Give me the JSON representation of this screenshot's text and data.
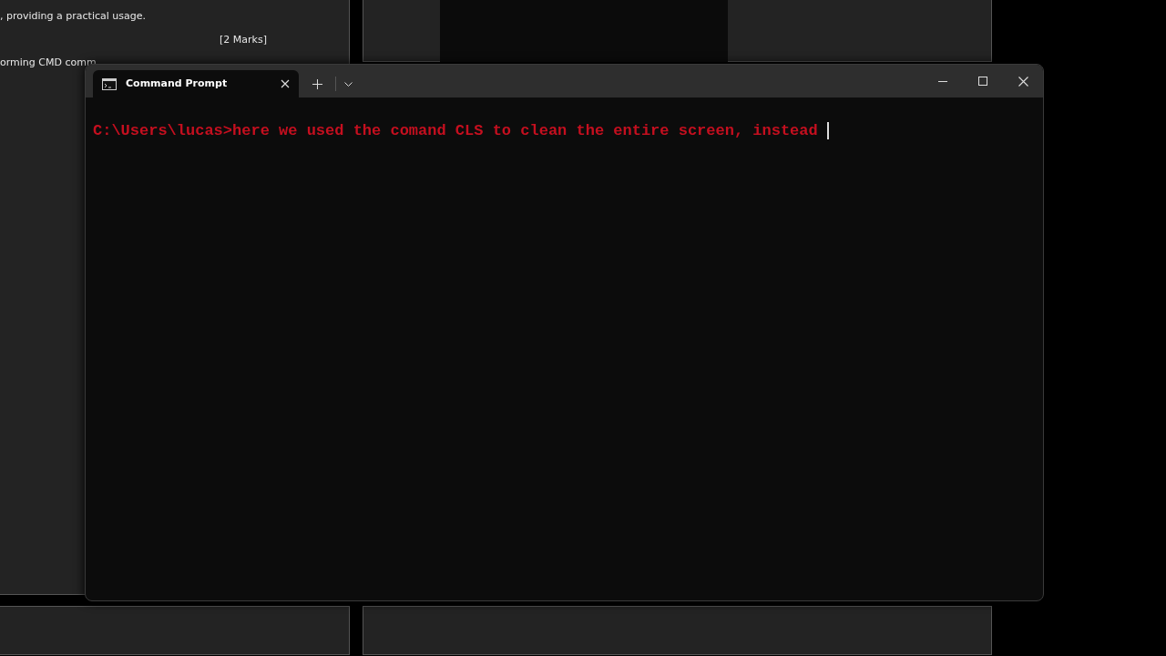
{
  "document": {
    "lines": [
      ", providing a practical usage.",
      "[2 Marks]",
      "orming CMD comm"
    ]
  },
  "terminal": {
    "tabs": [
      {
        "title": "Command Prompt",
        "selected": true
      }
    ],
    "lines": [
      "C:\\Users\\lucas>here we used the comand CLS to clean the entire screen, instead "
    ]
  }
}
